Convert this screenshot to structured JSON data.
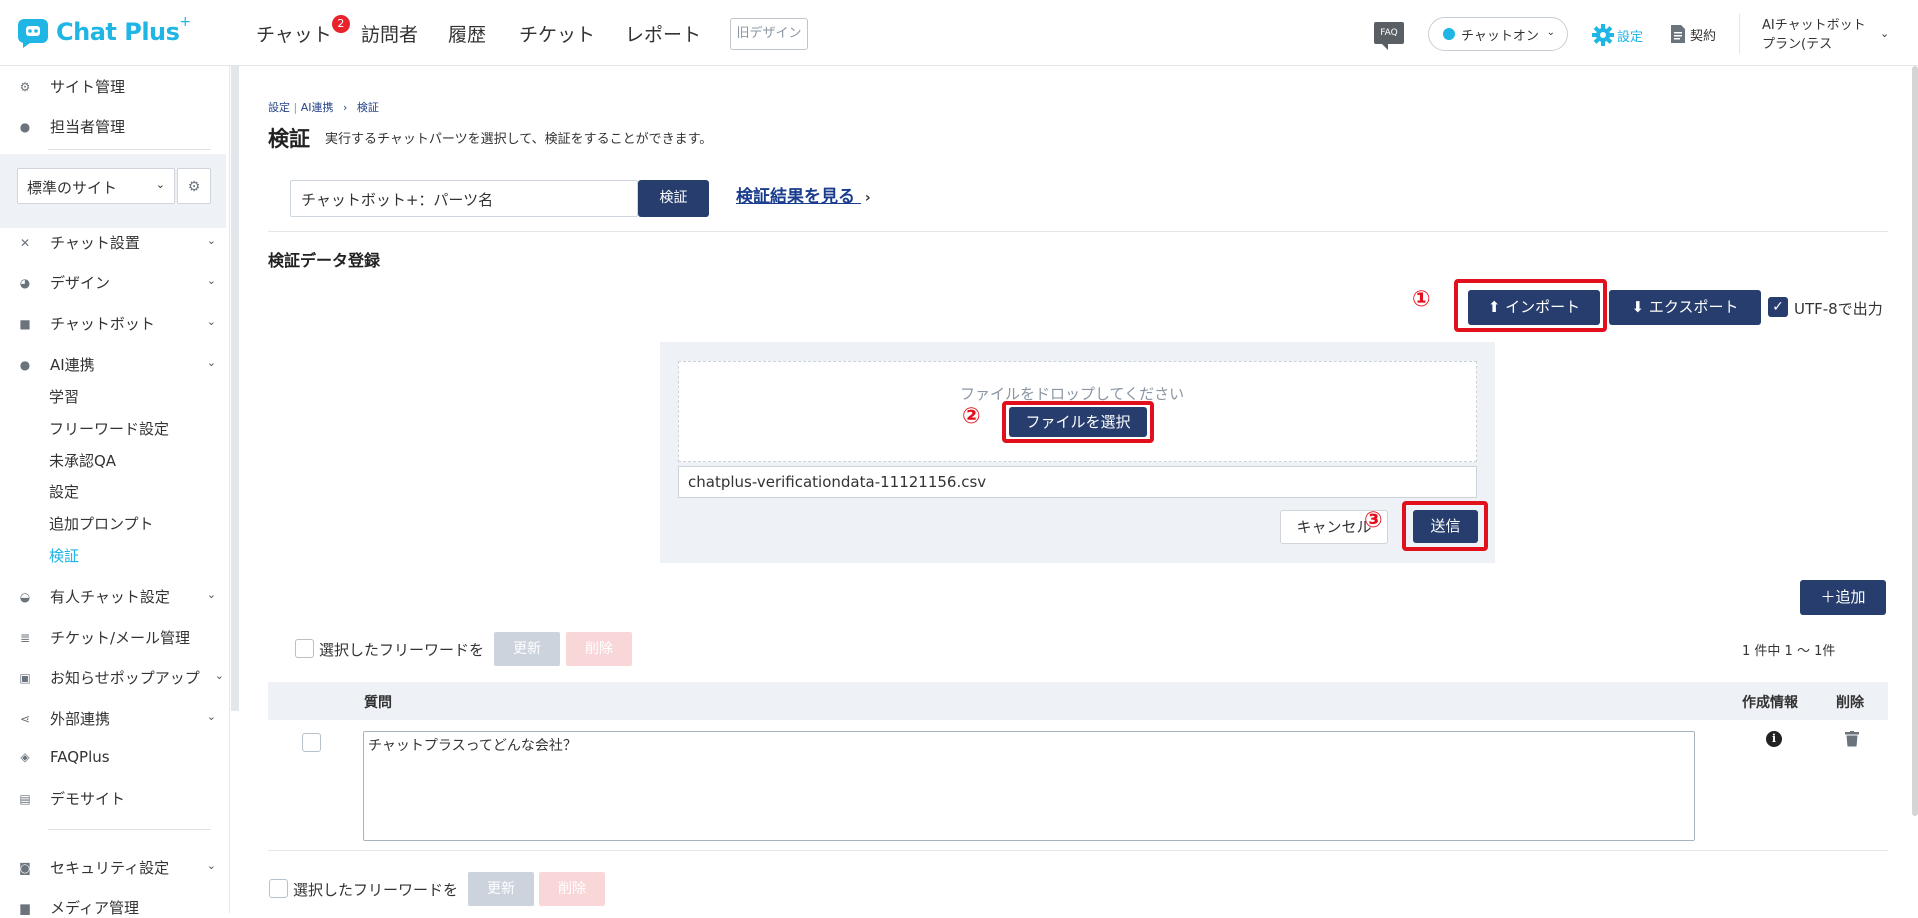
{
  "header": {
    "logo_text": "Chat Plus",
    "logo_sup": "+",
    "nav": [
      {
        "label": "チャット",
        "badge": "2"
      },
      {
        "label": "訪問者"
      },
      {
        "label": "履歴"
      },
      {
        "label": "チケット"
      },
      {
        "label": "レポート"
      }
    ],
    "old_design_label": "旧デザイン",
    "faq_label": "FAQ",
    "status_label": "チャットオン",
    "settings_label": "設定",
    "contract_label": "契約",
    "plan_label": "AIチャットボットプラン(テス"
  },
  "sidebar": {
    "top_items": [
      {
        "label": "サイト管理",
        "icon": "site-gear-icon"
      },
      {
        "label": "担当者管理",
        "icon": "users-icon"
      }
    ],
    "site_select_value": "標準のサイト",
    "menu": [
      {
        "label": "チャット設置",
        "icon": "tools-icon"
      },
      {
        "label": "デザイン",
        "icon": "palette-icon"
      },
      {
        "label": "チャットボット",
        "icon": "chat-bubble-icon"
      },
      {
        "label": "AI連携",
        "icon": "ai-icon"
      }
    ],
    "ai_sub": [
      "学習",
      "フリーワード設定",
      "未承認QA",
      "設定",
      "追加プロンプト",
      "検証"
    ],
    "menu2": [
      {
        "label": "有人チャット設定",
        "icon": "headset-icon"
      },
      {
        "label": "チケット/メール管理",
        "icon": "list-icon"
      },
      {
        "label": "お知らせポップアップ",
        "icon": "popup-icon"
      },
      {
        "label": "外部連携",
        "icon": "share-icon"
      },
      {
        "label": "FAQPlus",
        "icon": "faq-plus-icon"
      },
      {
        "label": "デモサイト",
        "icon": "demo-icon"
      },
      {
        "label": "セキュリティ設定",
        "icon": "shield-icon"
      },
      {
        "label": "メディア管理",
        "icon": "media-icon"
      }
    ]
  },
  "main": {
    "breadcrumb": {
      "part1": "設定",
      "part2": "AI連携",
      "sep": "›",
      "current": "検証"
    },
    "title": "検証",
    "description": "実行するチャットパーツを選択して、検証をすることができます。",
    "parts_input_value": "チャットボット+：パーツ名",
    "verify_button": "検証",
    "result_link": "検証結果を見る",
    "result_link_arrow": "›",
    "section_title": "検証データ登録",
    "import_button": "インポート",
    "export_button": "エクスポート",
    "utf8_label": "UTF-8で出力",
    "utf8_checked": true,
    "drop_text": "ファイルをドロップしてください",
    "choose_file_button": "ファイルを選択",
    "file_name": "chatplus-verificationdata-11121156.csv",
    "cancel_button": "キャンセル",
    "send_button": "送信",
    "annotations": [
      "①",
      "②",
      "③"
    ],
    "add_button": "＋追加",
    "bulk_label": "選択したフリーワードを",
    "update_button": "更新",
    "delete_button": "削除",
    "count_text": "1 件中 1 ～ 1件",
    "table": {
      "headers": {
        "question": "質問",
        "created": "作成情報",
        "delete": "削除"
      },
      "rows": [
        {
          "question": "チャットプラスってどんな会社？"
        }
      ]
    },
    "accent_color": "#263d6e",
    "highlight_color": "#e20f1c"
  }
}
